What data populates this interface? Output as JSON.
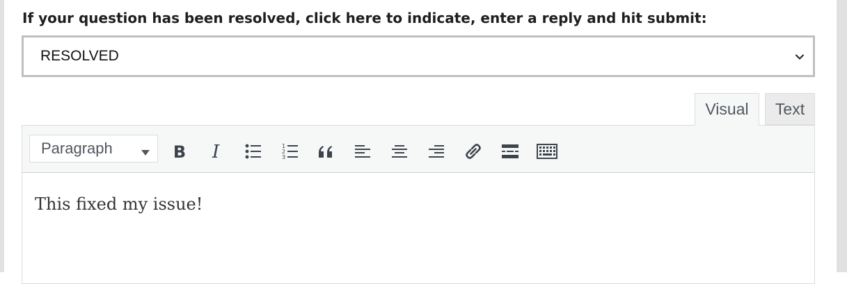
{
  "form": {
    "resolve_prompt": "If your question has been resolved, click here to indicate, enter a reply and hit submit:",
    "status_select": {
      "selected": "RESOLVED",
      "icon": "chevron-down-icon"
    }
  },
  "editor_tabs": [
    {
      "label": "Visual",
      "active": true
    },
    {
      "label": "Text",
      "active": false
    }
  ],
  "toolbar": {
    "format_select": {
      "selected": "Paragraph",
      "icon": "caret-down-icon"
    },
    "buttons": [
      {
        "name": "bold",
        "icon": "bold-icon"
      },
      {
        "name": "italic",
        "icon": "italic-icon"
      },
      {
        "name": "bulleted-list",
        "icon": "bulleted-list-icon"
      },
      {
        "name": "numbered-list",
        "icon": "numbered-list-icon"
      },
      {
        "name": "blockquote",
        "icon": "blockquote-icon"
      },
      {
        "name": "align-left",
        "icon": "align-left-icon"
      },
      {
        "name": "align-center",
        "icon": "align-center-icon"
      },
      {
        "name": "align-right",
        "icon": "align-right-icon"
      },
      {
        "name": "insert-link",
        "icon": "link-icon"
      },
      {
        "name": "read-more",
        "icon": "read-more-icon"
      },
      {
        "name": "toolbar-toggle",
        "icon": "keyboard-icon"
      }
    ]
  },
  "editor": {
    "content": "This fixed my issue!"
  },
  "colors": {
    "text": "#1e1e1e",
    "icon": "#3c434a",
    "toolbar_bg": "#f6f7f7",
    "border": "#dcdcde",
    "select_border": "#bfbfbf",
    "page_frame": "#e1e1e1"
  }
}
